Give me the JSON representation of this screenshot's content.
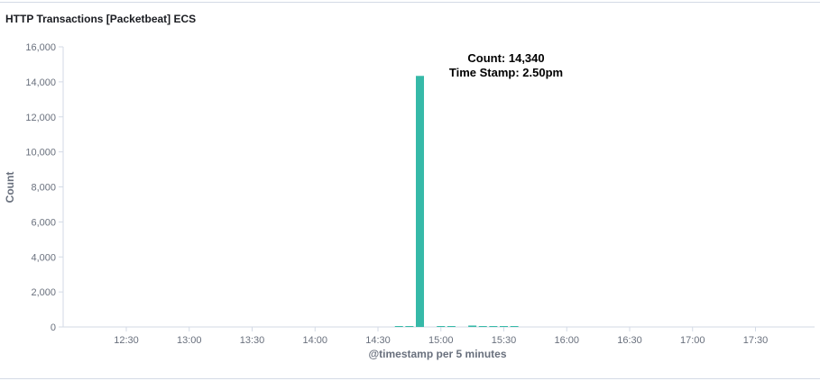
{
  "panel": {
    "title": "HTTP Transactions [Packetbeat] ECS"
  },
  "annotation": {
    "line1": "Count: 14,340",
    "line2": "Time Stamp: 2.50pm"
  },
  "chart_data": {
    "type": "bar",
    "title": "HTTP Transactions [Packetbeat] ECS",
    "xlabel": "@timestamp per 5 minutes",
    "ylabel": "Count",
    "x_tick_labels": [
      "12:30",
      "13:00",
      "13:30",
      "14:00",
      "14:30",
      "15:00",
      "15:30",
      "16:00",
      "16:30",
      "17:00",
      "17:30"
    ],
    "y_tick_labels": [
      "0",
      "2,000",
      "4,000",
      "6,000",
      "8,000",
      "10,000",
      "12,000",
      "14,000",
      "16,000"
    ],
    "ylim": [
      0,
      16000
    ],
    "categories": [
      "14:35",
      "14:40",
      "14:45",
      "14:50",
      "14:55",
      "15:00",
      "15:05",
      "15:10",
      "15:15",
      "15:20",
      "15:25",
      "15:30",
      "15:35",
      "15:40"
    ],
    "values": [
      0,
      20,
      5,
      14340,
      0,
      50,
      10,
      0,
      80,
      5,
      40,
      10,
      20,
      0
    ],
    "color": "#36b9a8",
    "grid": false,
    "legend": "none"
  }
}
